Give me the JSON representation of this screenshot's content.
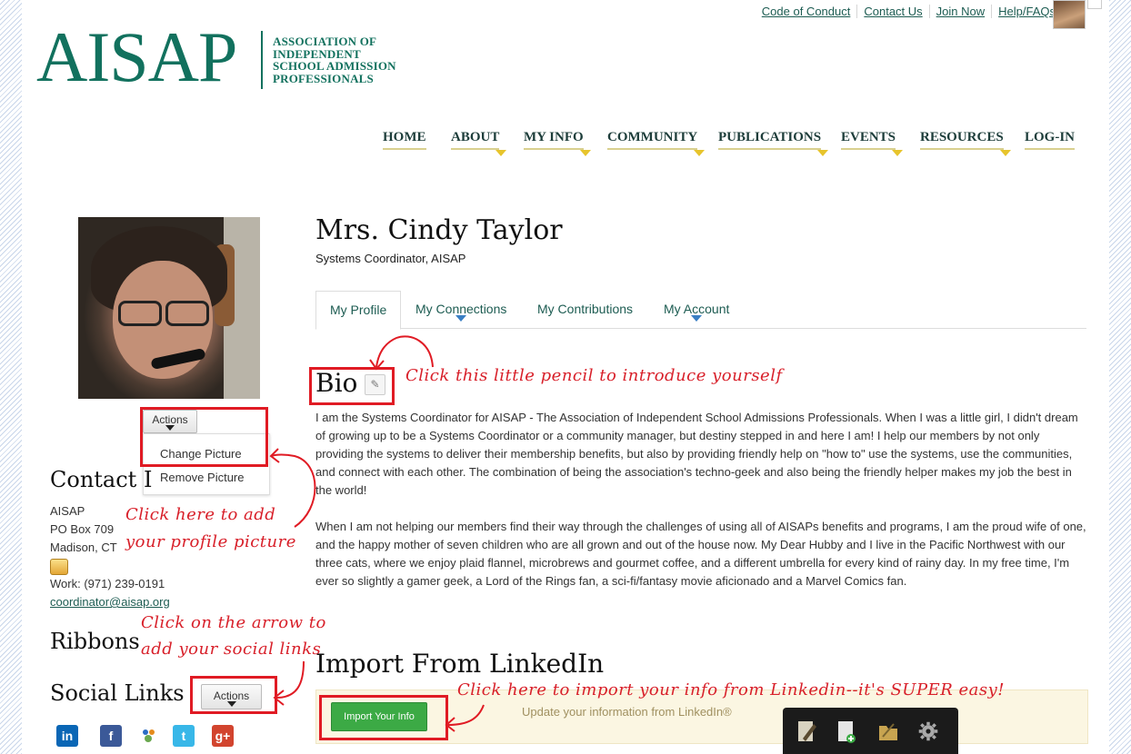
{
  "top_links": [
    "Code of Conduct",
    "Contact Us",
    "Join Now",
    "Help/FAQs"
  ],
  "logo": {
    "big": "AISAP",
    "sub_lines": [
      "ASSOCIATION OF",
      "INDEPENDENT",
      "SCHOOL ADMISSION",
      "PROFESSIONALS"
    ]
  },
  "nav": [
    "HOME",
    "ABOUT",
    "MY INFO",
    "COMMUNITY",
    "PUBLICATIONS",
    "EVENTS",
    "RESOURCES",
    "LOG-IN"
  ],
  "sidebar": {
    "actions_label": "Actions",
    "menu": [
      "Change Picture",
      "Remove Picture"
    ],
    "contact_heading": "Contact I",
    "contact_lines": [
      "AISAP",
      "PO Box 709",
      "Madison, CT"
    ],
    "work_phone": "Work: (971) 239-0191",
    "email": "coordinator@aisap.org",
    "ribbons_heading": "Ribbons",
    "social_heading": "Social Links",
    "social_actions_label": "Actions"
  },
  "profile": {
    "name": "Mrs. Cindy Taylor",
    "title": "Systems Coordinator, AISAP",
    "tabs": [
      "My Profile",
      "My Connections",
      "My Contributions",
      "My Account"
    ],
    "bio_heading": "Bio",
    "bio_paragraphs": [
      "I am the Systems Coordinator for AISAP - The Association of Independent School Admissions Professionals. When I was a little girl, I didn't dream of growing up to be a Systems Coordinator or a community manager, but destiny stepped in and here I am! I help our members by not only providing the systems to deliver their membership benefits, but also by providing friendly help on \"how to\" use the systems, use the communities, and connect with each other. The combination of being the association's techno-geek and also being the friendly helper makes my job the best in the world!",
      "When I am not helping our members find their way through the challenges of using all of AISAPs benefits and programs, I am the proud wife of one, and the happy mother of seven children who are all grown and out of the house now. My Dear Hubby and I live in the Pacific Northwest with our three cats, where we enjoy plaid flannel, microbrews and gourmet coffee, and a different umbrella for every kind of rainy day. In my free time, I'm ever so slightly a gamer geek, a Lord of the Rings fan, a sci-fi/fantasy movie aficionado and a Marvel Comics fan."
    ],
    "linkedin_heading": "Import From LinkedIn",
    "import_button": "Import Your Info",
    "import_note": "Update your information from LinkedIn®"
  },
  "annotations": {
    "pencil": "Click this little pencil to introduce yourself",
    "picture_1": "Click here to add",
    "picture_2": "your profile picture",
    "social_1": "Click on the arrow to",
    "social_2": "add your social links",
    "linkedin": "Click here to import your info from Linkedin--it's SUPER easy!"
  },
  "colors": {
    "brand_green": "#12715e",
    "link": "#1d5c52",
    "annotation_red": "#e01b24",
    "import_green": "#3caa45"
  }
}
